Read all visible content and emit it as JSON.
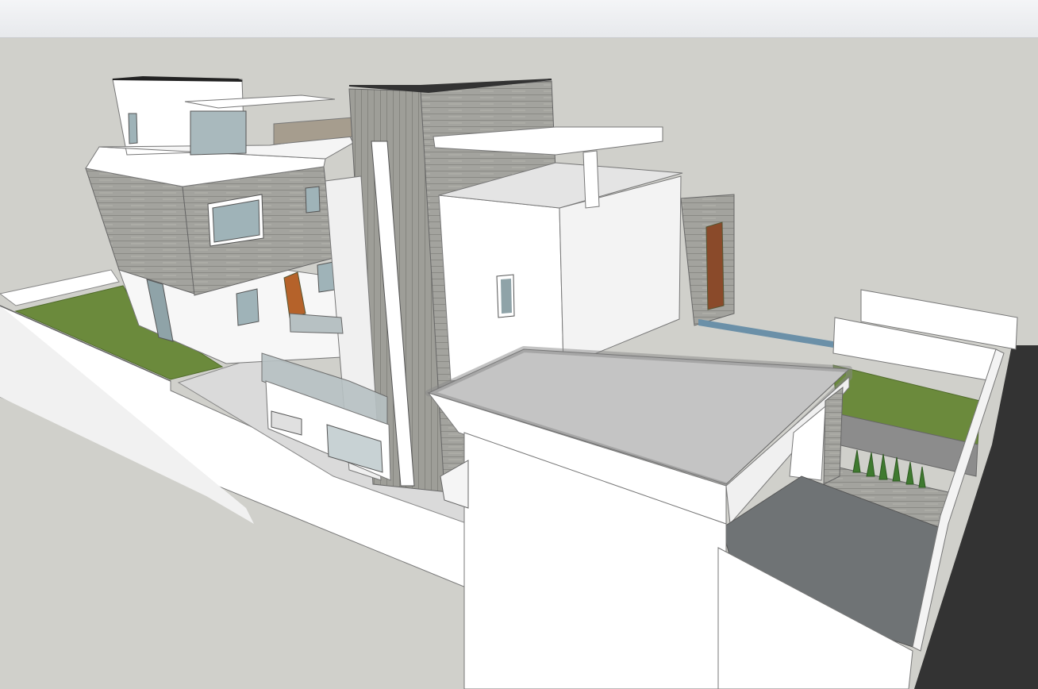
{
  "window": {
    "title": ""
  },
  "colors": {
    "ground": "#d0d0cb",
    "road": "#333333",
    "white_wall": "#ffffff",
    "shade_wall": "#ececec",
    "wood_cladding": "#9c9c96",
    "lawn": "#6b8a3c",
    "roof_slab": "#c9c9c9",
    "paving": "#6f7375",
    "door_wood": "#b5622a",
    "glass": "#9fb3b8"
  },
  "icons": [
    "3d-model-viewport"
  ]
}
